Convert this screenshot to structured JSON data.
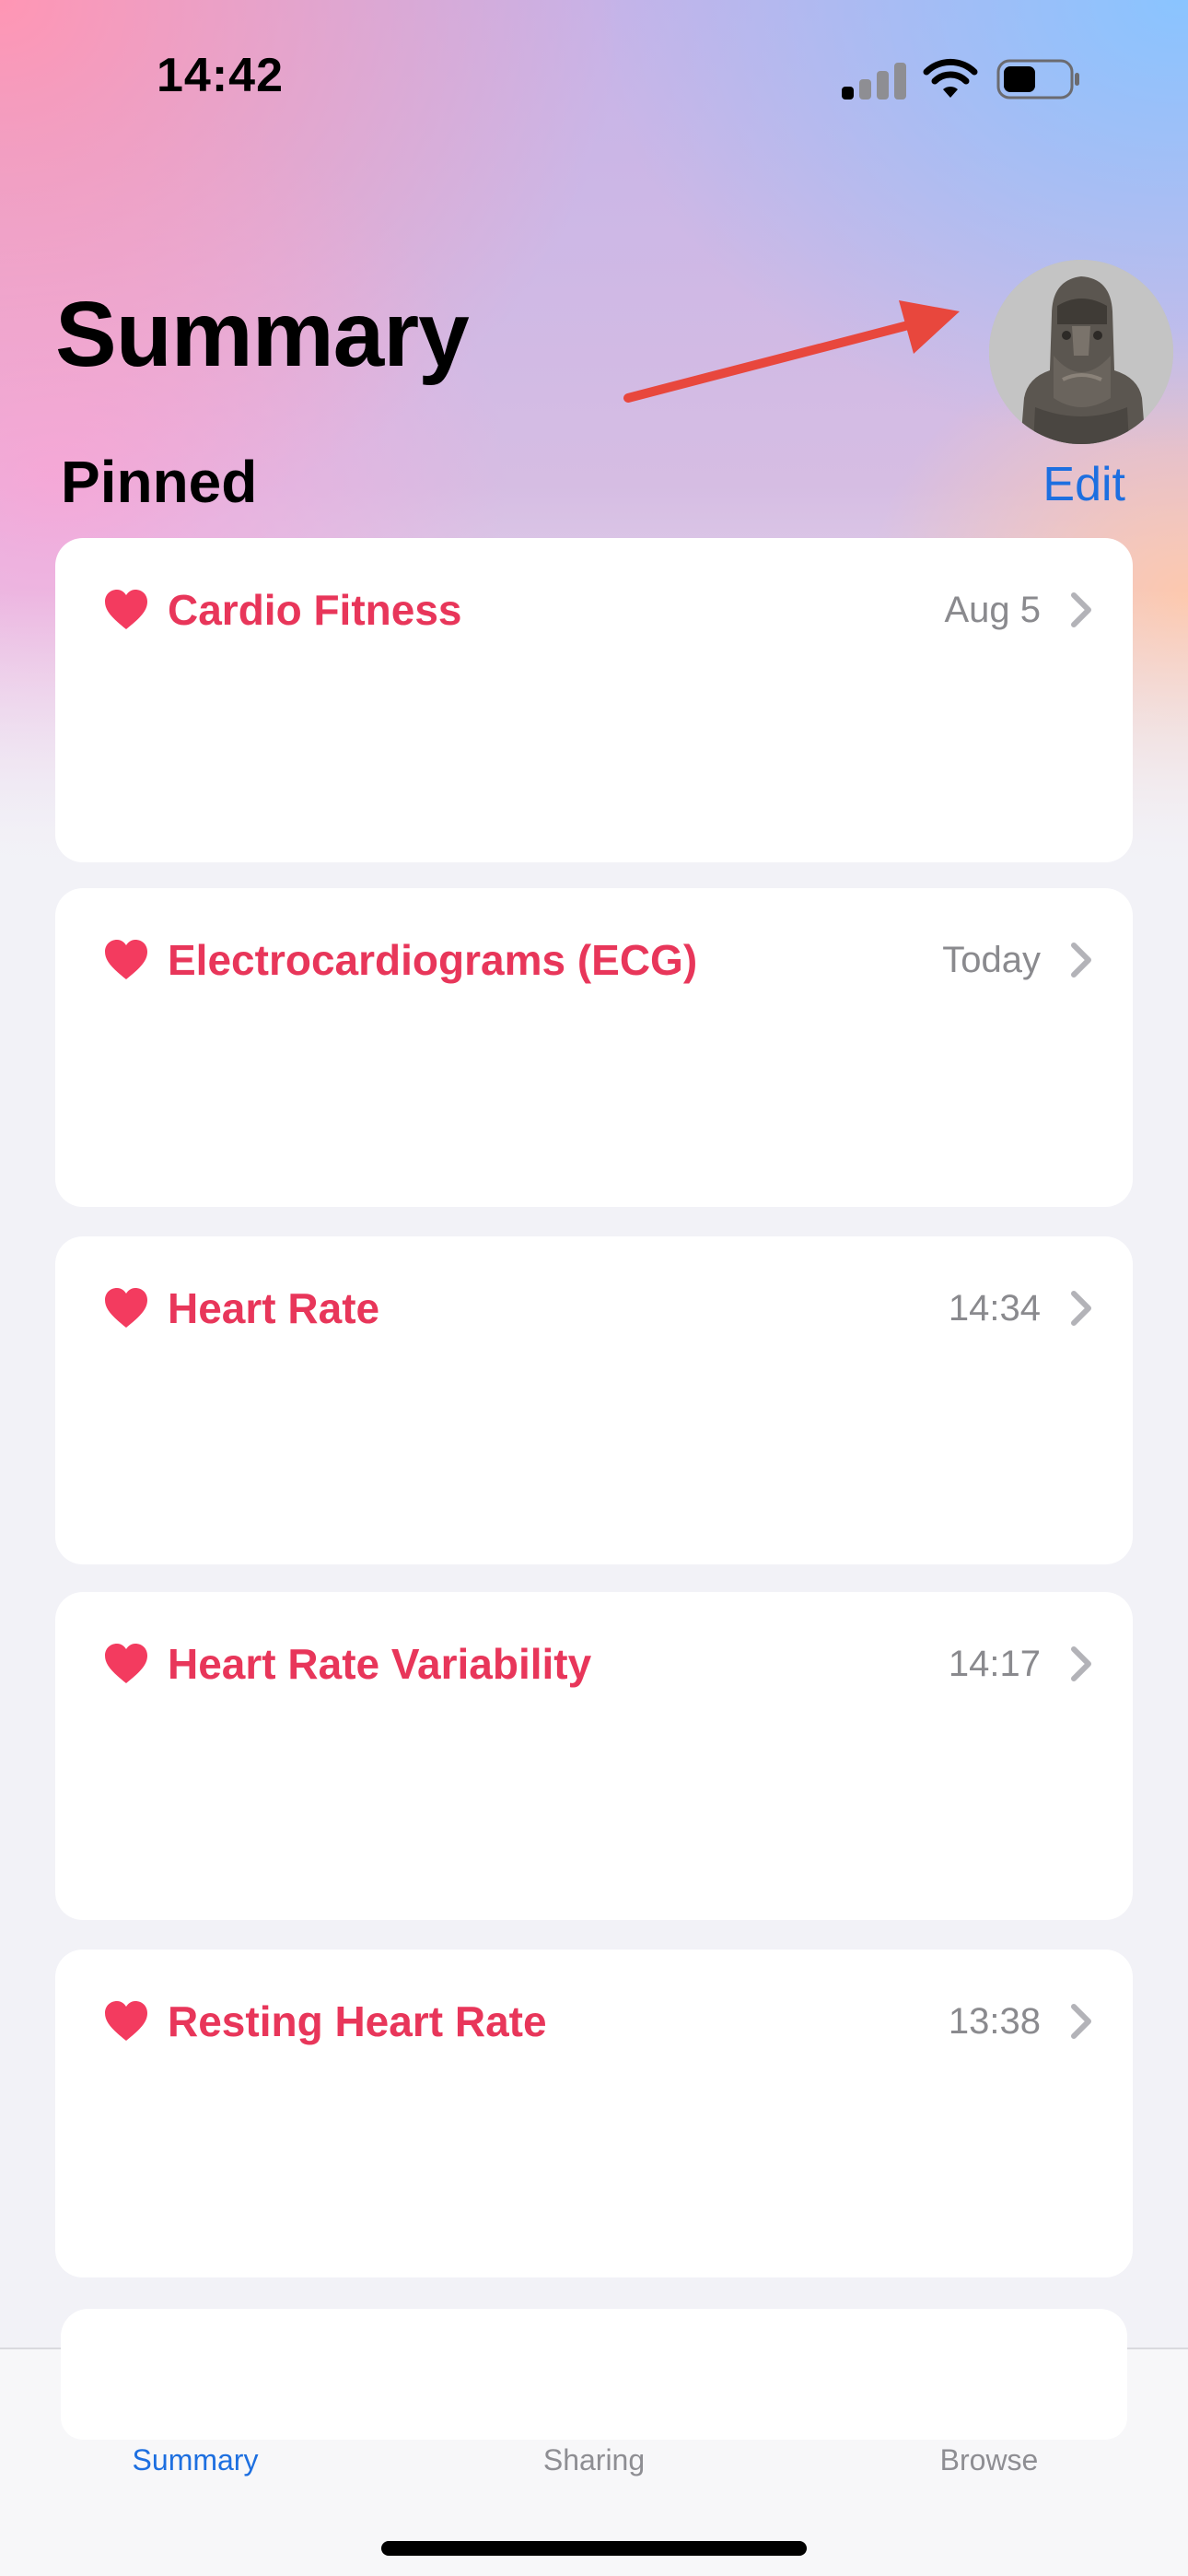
{
  "status_bar": {
    "time": "14:42"
  },
  "header": {
    "title": "Summary",
    "avatar_icon": "profile-photo-icon"
  },
  "pinned": {
    "section_title": "Pinned",
    "edit_label": "Edit"
  },
  "cards": [
    {
      "title": "Cardio Fitness",
      "time": "Aug 5",
      "icon": "heart-icon"
    },
    {
      "title": "Electrocardiograms (ECG)",
      "time": "Today",
      "icon": "heart-icon"
    },
    {
      "title": "Heart Rate",
      "time": "14:34",
      "icon": "heart-icon"
    },
    {
      "title": "Heart Rate Variability",
      "time": "14:17",
      "icon": "heart-icon"
    },
    {
      "title": "Resting Heart Rate",
      "time": "13:38",
      "icon": "heart-icon"
    }
  ],
  "tabs": [
    {
      "label": "Summary",
      "active": true
    },
    {
      "label": "Sharing",
      "active": false
    },
    {
      "label": "Browse",
      "active": false
    }
  ],
  "colors": {
    "accent": "#1d6fe0",
    "heart": "#e8365a",
    "arrow": "#e8473d"
  }
}
